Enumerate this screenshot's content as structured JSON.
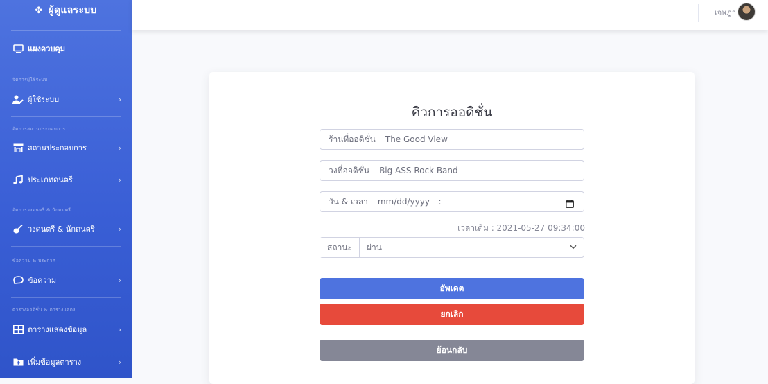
{
  "sidebar": {
    "brand": "ผู้ดูแลระบบ",
    "dashboard": "แผงควบคุม",
    "sections": [
      {
        "heading": "จัดการผู้ใช้ระบบ"
      },
      {
        "heading": "จัดการสถานประกอบการ"
      },
      {
        "heading": "จัดการวงดนตรี & นักดนตรี"
      },
      {
        "heading": "ข้อความ & ประกาศ"
      },
      {
        "heading": "ตารางออดิชั่น & ตารางแสดง"
      }
    ],
    "items": [
      {
        "label": "ผู้ใช้ระบบ"
      },
      {
        "label": "สถานประกอบการ"
      },
      {
        "label": "ประเภทดนตรี"
      },
      {
        "label": "วงดนตรี & นักดนตรี"
      },
      {
        "label": "ข้อความ"
      },
      {
        "label": "ตารางแสดงข้อมูล"
      },
      {
        "label": "เพิ่มข้อมูลตาราง"
      }
    ]
  },
  "topbar": {
    "user_name": "เจษฎา"
  },
  "form": {
    "title": "คิวการออดิชั่น",
    "venue": {
      "label": "ร้านที่ออดิชั่น",
      "value": "The Good View"
    },
    "band": {
      "label": "วงที่ออดิชั่น",
      "value": "Big ASS Rock Band"
    },
    "datetime": {
      "label": "วัน & เวลา",
      "placeholder": "mm/dd/yyyy --:-- --"
    },
    "old_time": "เวลาเดิม : 2021-05-27 09:34:00",
    "status": {
      "label": "สถานะ",
      "value": "ผ่าน"
    },
    "update_button": "อัพเดต",
    "cancel_button": "ยกเลิก",
    "back_button": "ย้อนกลับ"
  },
  "colors": {
    "sidebar": "#4e73df",
    "primary": "#4e73df",
    "danger": "#e74a3b",
    "secondary": "#858796"
  }
}
